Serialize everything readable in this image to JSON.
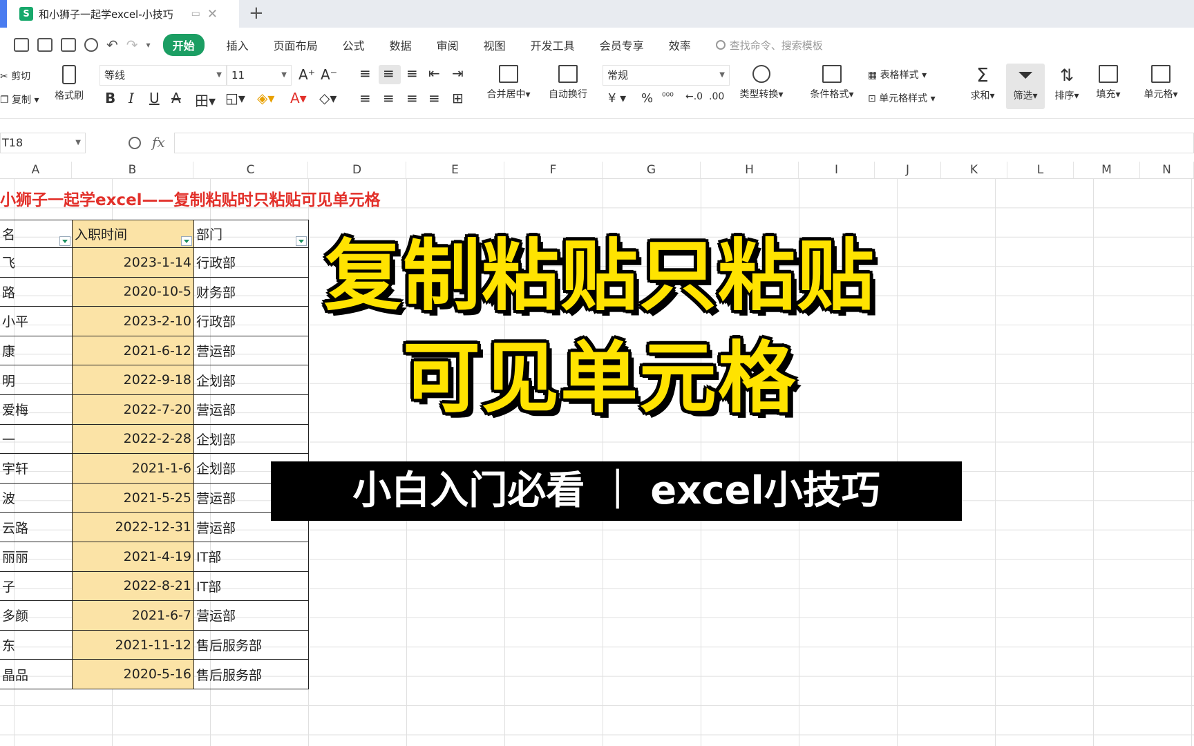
{
  "tab": {
    "app_icon_glyph": "S",
    "title": "和小狮子一起学excel-小技巧"
  },
  "menu": {
    "tabs": [
      "开始",
      "插入",
      "页面布局",
      "公式",
      "数据",
      "审阅",
      "视图",
      "开发工具",
      "会员专享",
      "效率"
    ],
    "search_placeholder": "查找命令、搜索模板"
  },
  "ribbon": {
    "cut": "剪切",
    "copy": "复制",
    "format_painter": "格式刷",
    "font_name": "等线",
    "font_size": "11",
    "merge_center": "合并居中",
    "wrap_text": "自动换行",
    "number_format": "常规",
    "currency_symbol": "¥",
    "percent_symbol": "%",
    "type_convert": "类型转换",
    "conditional_format": "条件格式",
    "table_style": "表格样式",
    "cell_style": "单元格样式",
    "sum": "求和",
    "filter": "筛选",
    "sort": "排序",
    "fill": "填充",
    "cell": "单元格"
  },
  "formula_bar": {
    "cell_ref": "T18",
    "fx_label": "fx",
    "formula": ""
  },
  "sheet": {
    "columns": [
      "A",
      "B",
      "C",
      "D",
      "E",
      "F",
      "G",
      "H",
      "I",
      "J",
      "K",
      "L",
      "M",
      "N"
    ],
    "title": "小狮子一起学excel——复制粘贴时只粘贴可见单元格",
    "headers": [
      "名",
      "入职时间",
      "部门"
    ],
    "rows": [
      {
        "name": "飞",
        "date": "2023-1-14",
        "dept": "行政部"
      },
      {
        "name": "路",
        "date": "2020-10-5",
        "dept": "财务部"
      },
      {
        "name": "小平",
        "date": "2023-2-10",
        "dept": "行政部"
      },
      {
        "name": "康",
        "date": "2021-6-12",
        "dept": "营运部"
      },
      {
        "name": "明",
        "date": "2022-9-18",
        "dept": "企划部"
      },
      {
        "name": "爱梅",
        "date": "2022-7-20",
        "dept": "营运部"
      },
      {
        "name": "一",
        "date": "2022-2-28",
        "dept": "企划部"
      },
      {
        "name": "宇轩",
        "date": "2021-1-6",
        "dept": "企划部"
      },
      {
        "name": "波",
        "date": "2021-5-25",
        "dept": "营运部"
      },
      {
        "name": "云路",
        "date": "2022-12-31",
        "dept": "营运部"
      },
      {
        "name": "丽丽",
        "date": "2021-4-19",
        "dept": "IT部"
      },
      {
        "name": "子",
        "date": "2022-8-21",
        "dept": "IT部"
      },
      {
        "name": "多颜",
        "date": "2021-6-7",
        "dept": "营运部"
      },
      {
        "name": "东",
        "date": "2021-11-12",
        "dept": "售后服务部"
      },
      {
        "name": "晶品",
        "date": "2020-5-16",
        "dept": "售后服务部"
      }
    ]
  },
  "overlay": {
    "line1": "复制粘贴只粘贴",
    "line2": "可见单元格",
    "banner": "小白入门必看 ｜ excel小技巧"
  }
}
